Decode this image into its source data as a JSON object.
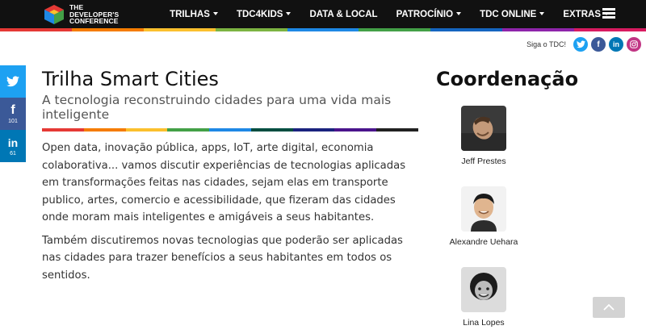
{
  "header": {
    "logo_lines": [
      "THE",
      "DEVELOPER'S",
      "CONFERENCE"
    ],
    "nav": [
      {
        "label": "TRILHAS",
        "dropdown": true
      },
      {
        "label": "TDC4KIDS",
        "dropdown": true
      },
      {
        "label": "DATA & LOCAL",
        "dropdown": false
      },
      {
        "label": "PATROCÍNIO",
        "dropdown": true
      },
      {
        "label": "TDC ONLINE",
        "dropdown": true
      },
      {
        "label": "EXTRAS",
        "dropdown": true
      }
    ],
    "menu_icon": "hamburger-icon",
    "rainbow_colors": [
      "#e53935",
      "#f57c00",
      "#fbc02d",
      "#7cb342",
      "#1e88e5",
      "#43a047",
      "#1565c0",
      "#8e24aa",
      "#d81b60"
    ]
  },
  "follow": {
    "label": "Siga o TDC!",
    "networks": [
      {
        "icon": "twitter-icon",
        "glyph": "t",
        "color": "#1da1f2"
      },
      {
        "icon": "facebook-icon",
        "glyph": "f",
        "color": "#3b5998"
      },
      {
        "icon": "linkedin-icon",
        "glyph": "in",
        "color": "#0077b5"
      },
      {
        "icon": "instagram-icon",
        "glyph": "◎",
        "color": "#c13584"
      }
    ]
  },
  "share": [
    {
      "icon": "twitter-icon",
      "glyph": "t",
      "count": "",
      "color": "#1da1f2"
    },
    {
      "icon": "facebook-icon",
      "glyph": "f",
      "count": "101",
      "color": "#3b5998"
    },
    {
      "icon": "linkedin-icon",
      "glyph": "in",
      "count": "61",
      "color": "#0077b5"
    }
  ],
  "main": {
    "title": "Trilha Smart Cities",
    "subtitle": "A tecnologia reconstruindo cidades para uma vida mais inteligente",
    "rainbow_colors": [
      "#e53935",
      "#f57c00",
      "#fbc02d",
      "#43a047",
      "#1e88e5",
      "#004d40",
      "#1a237e",
      "#4a148c",
      "#212121"
    ],
    "paragraphs": [
      "Open data, inovação pública, apps, IoT, arte digital, economia colaborativa... vamos discutir experiências de tecnologias aplicadas em transformações feitas nas cidades, sejam elas em transporte publico, artes, comercio e acessibilidade, que fizeram das cidades onde moram mais inteligentes e amigáveis a seus habitantes.",
      "Também discutiremos novas tecnologias que poderão ser aplicadas nas cidades para trazer benefícios a seus habitantes em todos os sentidos."
    ]
  },
  "coordination": {
    "title": "Coordenação",
    "people": [
      {
        "name": "Jeff Prestes"
      },
      {
        "name": "Alexandre Uehara"
      },
      {
        "name": "Lina Lopes"
      }
    ]
  },
  "back_to_top_icon": "chevron-up-icon"
}
